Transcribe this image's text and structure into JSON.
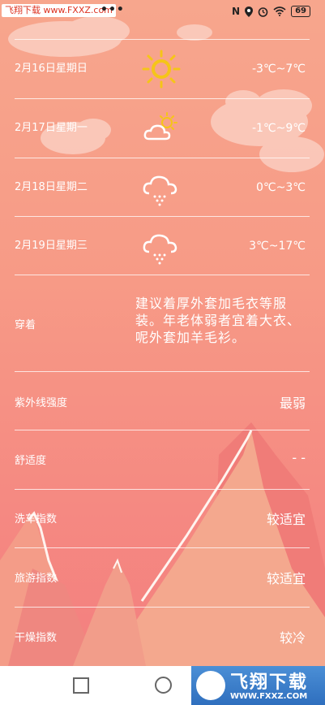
{
  "status_bar": {
    "watermark": "飞翔下载 www.FXXZ.com",
    "dots": "•••",
    "network": "N",
    "battery": "69"
  },
  "forecast": [
    {
      "date": "2月16日星期日",
      "icon": "sun-icon",
      "temp": "-3℃~7℃"
    },
    {
      "date": "2月17日星期一",
      "icon": "partly-cloudy-icon",
      "temp": "-1℃~9℃"
    },
    {
      "date": "2月18日星期二",
      "icon": "snow-cloud-icon",
      "temp": "0℃~3℃"
    },
    {
      "date": "2月19日星期三",
      "icon": "snow-cloud-icon",
      "temp": "3℃~17℃"
    }
  ],
  "indices": {
    "clothing": {
      "label": "穿着",
      "value": "建议着厚外套加毛衣等服装。年老体弱者宜着大衣、呢外套加羊毛衫。"
    },
    "uv": {
      "label": "紫外线强度",
      "value": "最弱"
    },
    "comfort": {
      "label": "舒适度",
      "value": "- -"
    },
    "car_wash": {
      "label": "洗车指数",
      "value": "较适宜"
    },
    "travel": {
      "label": "旅游指数",
      "value": "较适宜"
    },
    "drying": {
      "label": "干燥指数",
      "value": "较冷"
    }
  },
  "nav_watermark": {
    "title": "飞翔下载",
    "url": "WWW.FXXZ.COM"
  },
  "colors": {
    "background_top": "#f7a68d",
    "background_bottom": "#f47d7e",
    "mountain_light": "#f6b596",
    "mountain_dark": "#ee7372",
    "sun": "#f5c518"
  }
}
